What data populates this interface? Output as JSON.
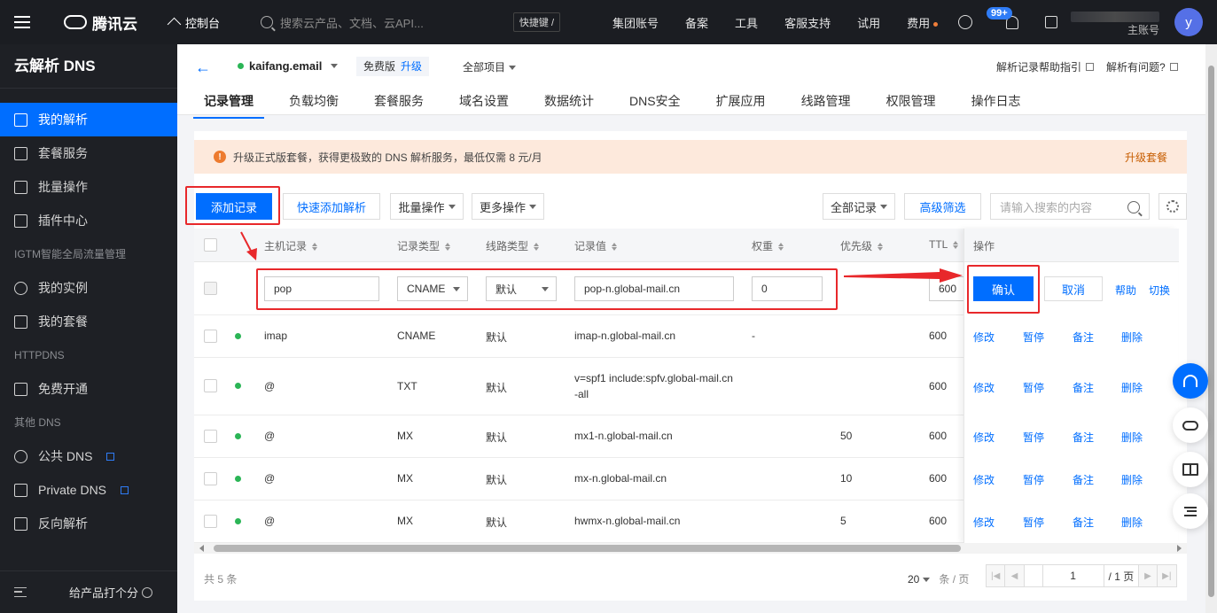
{
  "topbar": {
    "brand": "腾讯云",
    "console": "控制台",
    "search_placeholder": "搜索云产品、文档、云API...",
    "shortcut": "快捷键 /",
    "links": [
      "集团账号",
      "备案",
      "工具",
      "客服支持",
      "试用",
      "费用"
    ],
    "notifications_badge": "99+",
    "account_sub": "主账号",
    "avatar_letter": "y"
  },
  "sidebar": {
    "title": "云解析 DNS",
    "items": [
      {
        "label": "我的解析",
        "icon": "dns-icon",
        "active": true
      },
      {
        "label": "套餐服务",
        "icon": "package-icon"
      },
      {
        "label": "批量操作",
        "icon": "batch-icon"
      },
      {
        "label": "插件中心",
        "icon": "plugin-icon"
      }
    ],
    "group_igtm": "IGTM智能全局流量管理",
    "igtm_items": [
      {
        "label": "我的实例",
        "icon": "instance-icon"
      },
      {
        "label": "我的套餐",
        "icon": "package-icon"
      }
    ],
    "group_httpdns": "HTTPDNS",
    "httpdns_items": [
      {
        "label": "免费开通",
        "icon": "activate-icon"
      }
    ],
    "group_other": "其他 DNS",
    "other_items": [
      {
        "label": "公共 DNS",
        "icon": "globe-icon"
      },
      {
        "label": "Private DNS",
        "icon": "diamond-icon"
      },
      {
        "label": "反向解析",
        "icon": "reverse-icon"
      }
    ],
    "rate_label": "给产品打个分"
  },
  "header": {
    "domain": "kaifang.email",
    "plan": "免费版",
    "upgrade": "升级",
    "project": "全部项目",
    "help_guide": "解析记录帮助指引",
    "help_question": "解析有问题?",
    "tabs": [
      "记录管理",
      "负载均衡",
      "套餐服务",
      "域名设置",
      "数据统计",
      "DNS安全",
      "扩展应用",
      "线路管理",
      "权限管理",
      "操作日志"
    ]
  },
  "notice": {
    "text": "升级正式版套餐，获得更极致的 DNS 解析服务，最低仅需 8 元/月",
    "action": "升级套餐"
  },
  "toolbar": {
    "add": "添加记录",
    "quick_add": "快速添加解析",
    "batch": "批量操作",
    "more": "更多操作",
    "all_records": "全部记录",
    "advanced_filter": "高级筛选",
    "search_placeholder": "请输入搜索的内容"
  },
  "table": {
    "headers": {
      "host": "主机记录",
      "type": "记录类型",
      "line": "线路类型",
      "value": "记录值",
      "weight": "权重",
      "priority": "优先级",
      "ttl": "TTL",
      "ops": "操作"
    },
    "edit_row": {
      "host": "pop",
      "type": "CNAME",
      "line": "默认",
      "value": "pop-n.global-mail.cn",
      "weight": "0",
      "ttl": "600",
      "confirm": "确认",
      "cancel": "取消",
      "help": "帮助",
      "switch": "切换"
    },
    "rows": [
      {
        "host": "imap",
        "type": "CNAME",
        "line": "默认",
        "value": "imap-n.global-mail.cn",
        "value2": "",
        "weight": "-",
        "priority": "",
        "ttl": "600"
      },
      {
        "host": "@",
        "type": "TXT",
        "line": "默认",
        "value": "v=spf1 include:spfv.global-mail.cn",
        "value2": "-all",
        "weight": "",
        "priority": "",
        "ttl": "600"
      },
      {
        "host": "@",
        "type": "MX",
        "line": "默认",
        "value": "mx1-n.global-mail.cn",
        "value2": "",
        "weight": "",
        "priority": "50",
        "ttl": "600"
      },
      {
        "host": "@",
        "type": "MX",
        "line": "默认",
        "value": "mx-n.global-mail.cn",
        "value2": "",
        "weight": "",
        "priority": "10",
        "ttl": "600"
      },
      {
        "host": "@",
        "type": "MX",
        "line": "默认",
        "value": "hwmx-n.global-mail.cn",
        "value2": "",
        "weight": "",
        "priority": "5",
        "ttl": "600"
      }
    ],
    "row_actions": [
      "修改",
      "暂停",
      "备注",
      "删除"
    ]
  },
  "footer": {
    "total": "共 5 条",
    "page_size": "20",
    "page_size_unit": "条 / 页",
    "page": "1",
    "page_total": "/ 1 页"
  },
  "colors": {
    "accent": "#006eff",
    "annotation": "#e8282b",
    "notice_bg": "#fde9dc"
  }
}
